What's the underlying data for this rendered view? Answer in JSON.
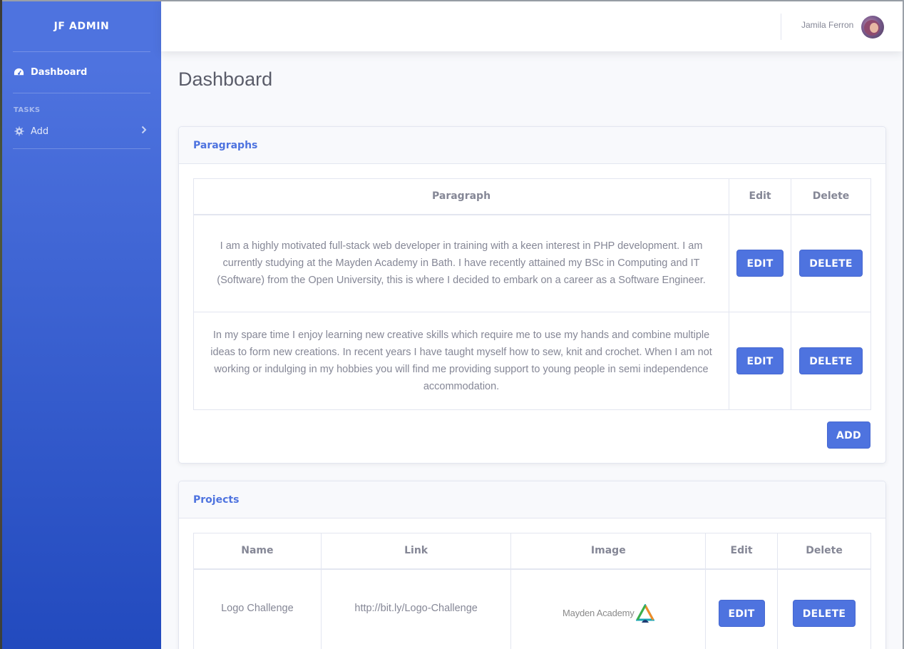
{
  "brand": "JF ADMIN",
  "sidebar": {
    "dashboard_label": "Dashboard",
    "tasks_heading": "TASKS",
    "add_label": "Add"
  },
  "topbar": {
    "username": "Jamila Ferron"
  },
  "page_title": "Dashboard",
  "paragraphs": {
    "title": "Paragraphs",
    "columns": [
      "Paragraph",
      "Edit",
      "Delete"
    ],
    "rows": [
      {
        "text": "I am a highly motivated full-stack web developer in training with a keen interest in PHP development. I am currently studying at the Mayden Academy in Bath. I have recently attained my BSc in Computing and IT (Software) from the Open University, this is where I decided to embark on a career as a Software Engineer."
      },
      {
        "text": "In my spare time I enjoy learning new creative skills which require me to use my hands and combine multiple ideas to form new creations. In recent years I have taught myself how to sew, knit and crochet. When I am not working or indulging in my hobbies you will find me providing support to young people in semi independence accommodation."
      }
    ],
    "edit_label": "EDIT",
    "delete_label": "DELETE",
    "add_label": "ADD"
  },
  "projects": {
    "title": "Projects",
    "columns": [
      "Name",
      "Link",
      "Image",
      "Edit",
      "Delete"
    ],
    "rows": [
      {
        "name": "Logo Challenge",
        "link": "http://bit.ly/Logo-Challenge",
        "image_logo_text": "Mayden Academy"
      }
    ],
    "edit_label": "EDIT",
    "delete_label": "DELETE"
  },
  "colors": {
    "primary": "#4e73df",
    "sidebar_dark": "#224abe",
    "text_muted": "#858796"
  }
}
